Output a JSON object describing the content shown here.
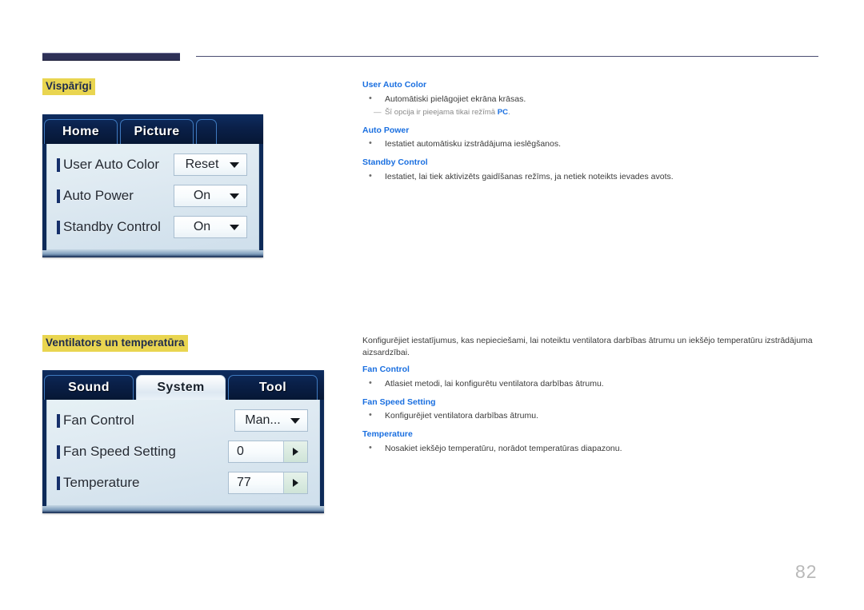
{
  "page": {
    "number": "82"
  },
  "sections": [
    {
      "heading": "Vispārīgi",
      "osd": {
        "tabs": [
          {
            "label": "Home",
            "active": false
          },
          {
            "label": "Picture",
            "active": false
          },
          {
            "label": "",
            "active": false
          }
        ],
        "rows": [
          {
            "label": "User Auto Color",
            "value": "Reset",
            "control": "dropdown",
            "icon": "chevron-down-icon"
          },
          {
            "label": "Auto Power",
            "value": "On",
            "control": "dropdown",
            "icon": "chevron-down-icon"
          },
          {
            "label": "Standby Control",
            "value": "On",
            "control": "dropdown",
            "icon": "chevron-down-icon"
          }
        ]
      },
      "text": {
        "intro": "",
        "items": [
          {
            "title": "User Auto Color",
            "bullet": "Automātiski pielāgojiet ekrāna krāsas.",
            "note_prefix": "Šī opcija ir pieejama tikai režīmā ",
            "note_emphasis": "PC",
            "note_suffix": "."
          },
          {
            "title": "Auto Power",
            "bullet": "Iestatiet automātisku izstrādājuma ieslēgšanos."
          },
          {
            "title": "Standby Control",
            "bullet": "Iestatiet, lai tiek aktivizēts gaidīšanas režīms, ja netiek noteikts ievades avots."
          }
        ]
      }
    },
    {
      "heading": "Ventilators un temperatūra",
      "osd": {
        "tabs": [
          {
            "label": "Sound",
            "active": false
          },
          {
            "label": "System",
            "active": true
          },
          {
            "label": "Tool",
            "active": false
          }
        ],
        "rows": [
          {
            "label": "Fan Control",
            "value": "Man...",
            "control": "dropdown",
            "icon": "chevron-down-icon"
          },
          {
            "label": "Fan Speed Setting",
            "value": "0",
            "control": "spinner",
            "icon": "chevron-right-icon"
          },
          {
            "label": "Temperature",
            "value": "77",
            "control": "spinner",
            "icon": "chevron-right-icon"
          }
        ]
      },
      "text": {
        "intro": "Konfigurējiet iestatījumus, kas nepieciešami, lai noteiktu ventilatora darbības ātrumu un iekšējo temperatūru izstrādājuma aizsardzībai.",
        "items": [
          {
            "title": "Fan Control",
            "bullet": "Atlasiet metodi, lai konfigurētu ventilatora darbības ātrumu."
          },
          {
            "title": "Fan Speed Setting",
            "bullet": "Konfigurējiet ventilatora darbības ātrumu."
          },
          {
            "title": "Temperature",
            "bullet": "Nosakiet iekšējo temperatūru, norādot temperatūras diapazonu."
          }
        ]
      }
    }
  ],
  "colors": {
    "heading_highlight": "#e9d550",
    "heading_text": "#1d2a4d",
    "subhead_blue": "#1a6fe0",
    "rule_navy": "#2e3157",
    "page_number_gray": "#b9b9b9"
  }
}
